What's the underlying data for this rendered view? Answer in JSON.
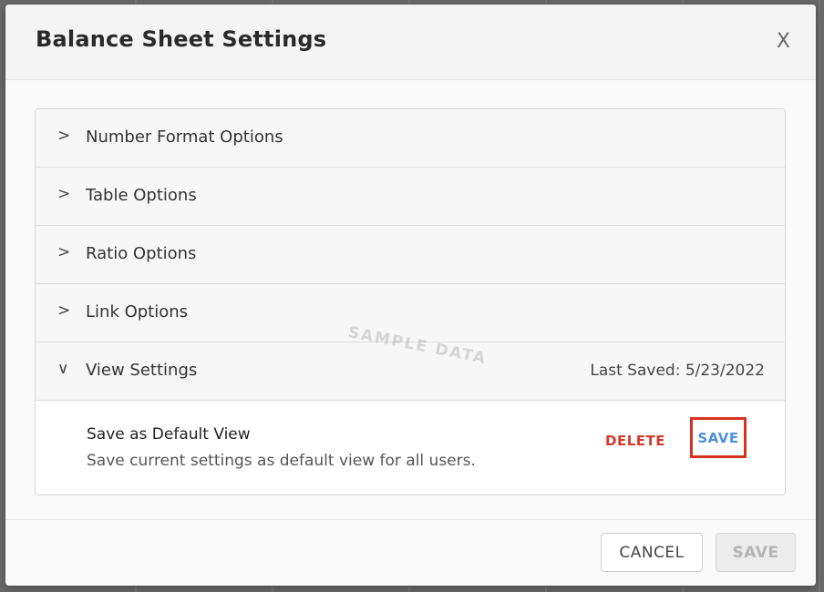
{
  "modal": {
    "title": "Balance Sheet Settings",
    "close_label": "X"
  },
  "accordion": {
    "sections": [
      {
        "label": "Number Format Options",
        "expanded": false,
        "chevron": ">"
      },
      {
        "label": "Table Options",
        "expanded": false,
        "chevron": ">"
      },
      {
        "label": "Ratio Options",
        "expanded": false,
        "chevron": ">"
      },
      {
        "label": "Link Options",
        "expanded": false,
        "chevron": ">"
      },
      {
        "label": "View Settings",
        "expanded": true,
        "chevron": "∨",
        "meta": "Last Saved: 5/23/2022"
      }
    ],
    "view_settings": {
      "default_view_title": "Save as Default View",
      "default_view_desc": "Save current settings as default view for all users.",
      "delete_label": "DELETE",
      "save_label": "SAVE"
    }
  },
  "watermark": "SAMPLE DATA",
  "footer": {
    "cancel_label": "CANCEL",
    "save_label": "SAVE",
    "save_disabled": true
  },
  "colors": {
    "delete": "#d63a2a",
    "save_link": "#4a90e2",
    "highlight_border": "#d5321f"
  }
}
